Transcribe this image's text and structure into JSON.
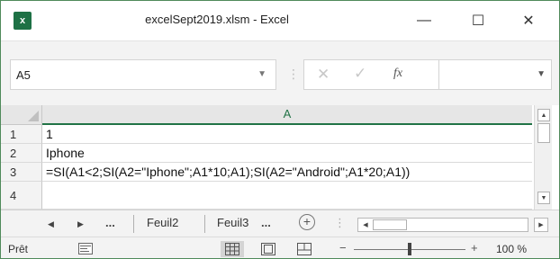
{
  "window": {
    "title": "excelSept2019.xlsm - Excel",
    "app_icon": "excel-icon",
    "controls": {
      "minimize": "—",
      "maximize": "☐",
      "close": "✕"
    }
  },
  "formula_bar": {
    "name_box": "A5",
    "name_box_icon": "chevron-down-icon",
    "separator": "⋮",
    "cancel_icon": "✕",
    "enter_icon": "✓",
    "function_label": "fx",
    "formula_value": "",
    "expand_icon": "chevron-down-icon"
  },
  "grid": {
    "column_header": "A",
    "rows": [
      {
        "number": "1",
        "value": "1"
      },
      {
        "number": "2",
        "value": "Iphone"
      },
      {
        "number": "3",
        "value": "=SI(A1<2;SI(A2=\"Iphone\";A1*10;A1);SI(A2=\"Android\";A1*20;A1))"
      },
      {
        "number": "4",
        "value": ""
      }
    ]
  },
  "sheet_tabs": {
    "prev": "◀",
    "next": "▶",
    "more": "...",
    "tabs": [
      "Feuil2",
      "Feuil3"
    ],
    "tab_more": "...",
    "add": "+",
    "separator": "⋮"
  },
  "status_bar": {
    "ready": "Prêt",
    "zoom_minus": "−",
    "zoom_plus": "+",
    "zoom_level": "100 %",
    "zoom_fraction": 0.5
  },
  "colors": {
    "accent": "#217346",
    "window_border": "#4f8a5a",
    "chrome_bg": "#f3f3f3"
  }
}
